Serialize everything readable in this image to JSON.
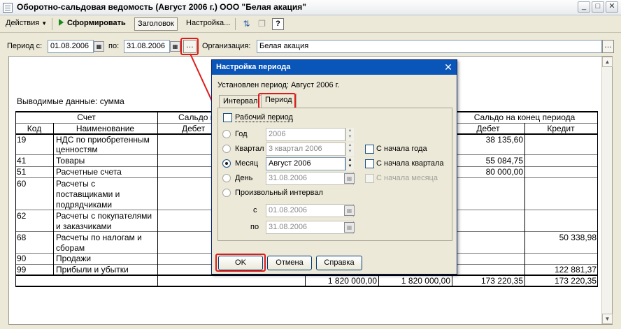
{
  "window": {
    "title": "Оборотно-сальдовая ведомость (Август 2006 г.) ООО \"Белая акация\""
  },
  "toolbar": {
    "actions": "Действия",
    "generate": "Сформировать",
    "header": "Заголовок",
    "settings": "Настройка..."
  },
  "params": {
    "period_from_label": "Период с:",
    "period_from": "01.08.2006",
    "period_to_label": "по:",
    "period_to": "31.08.2006",
    "org_label": "Организация:",
    "org": "Белая акация"
  },
  "report": {
    "output_label": "Выводимые данные: сумма",
    "headers": {
      "account": "Счет",
      "saldo_start": "Сальдо н",
      "saldo_end": "Сальдо на конец периода",
      "code": "Код",
      "name": "Наименование",
      "debit": "Дебет",
      "end_debit": "Дебет",
      "end_credit": "Кредит"
    },
    "rows": [
      {
        "code": "19",
        "name1": "НДС по приобретенным",
        "name2": "ценностям",
        "name3": "",
        "end_debit": "38 135,60",
        "end_credit": ""
      },
      {
        "code": "41",
        "name1": "Товары",
        "name2": "",
        "name3": "",
        "end_debit": "55 084,75",
        "end_credit": ""
      },
      {
        "code": "51",
        "name1": "Расчетные счета",
        "name2": "",
        "name3": "",
        "end_debit": "80 000,00",
        "end_credit": ""
      },
      {
        "code": "60",
        "name1": "Расчеты с",
        "name2": "поставщиками и",
        "name3": "подрядчиками",
        "end_debit": "",
        "end_credit": ""
      },
      {
        "code": "62",
        "name1": "Расчеты с покупателями",
        "name2": "и заказчиками",
        "name3": "",
        "end_debit": "",
        "end_credit": ""
      },
      {
        "code": "68",
        "name1": "Расчеты по налогам и",
        "name2": "сборам",
        "name3": "",
        "end_debit": "",
        "end_credit": "50 338,98"
      },
      {
        "code": "90",
        "name1": "Продажи",
        "name2": "",
        "name3": "",
        "end_debit": "",
        "end_credit": ""
      },
      {
        "code": "99",
        "name1": "Прибыли и убытки",
        "name2": "",
        "name3": "",
        "end_debit": "",
        "end_credit": "122 881,37"
      }
    ],
    "totals": {
      "turnover_debit": "1 820 000,00",
      "turnover_credit": "1 820 000,00",
      "end_debit": "173 220,35",
      "end_credit": "173 220,35"
    }
  },
  "dialog": {
    "title": "Настройка периода",
    "established": "Установлен период: Август 2006 г.",
    "tab_interval": "Интервал",
    "tab_period": "Период",
    "working_period": "Рабочий период",
    "year_label": "Год",
    "year_value": "2006",
    "quarter_label": "Квартал",
    "quarter_value": "3 квартал 2006",
    "month_label": "Месяц",
    "month_value": "Август 2006",
    "day_label": "День",
    "day_value": "31.08.2006",
    "custom_label": "Произвольный интервал",
    "from_label": "с",
    "from_value": "01.08.2006",
    "to_label": "по",
    "to_value": "31.08.2006",
    "from_year_start": "С начала года",
    "from_quarter_start": "С начала квартала",
    "from_month_start": "С начала месяца",
    "ok": "OK",
    "cancel": "Отмена",
    "help": "Справка"
  },
  "colors": {
    "highlight": "#e01b1b",
    "dialog_title": "#0a55b8"
  }
}
